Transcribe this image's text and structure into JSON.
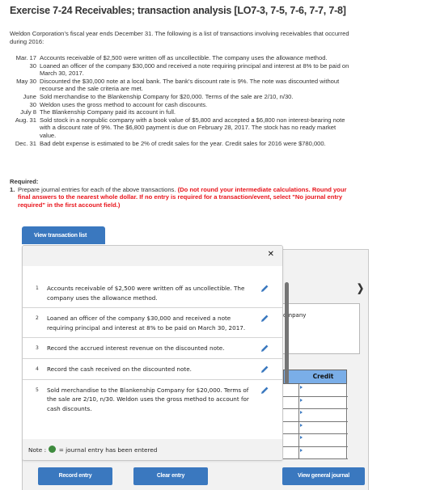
{
  "title": "Exercise 7-24 Receivables; transaction analysis [LO7-3, 7-5, 7-6, 7-7, 7-8]",
  "intro": "Weldon Corporation’s fiscal year ends December 31. The following is a list of transactions involving receivables that occurred during 2016:",
  "transactions": [
    {
      "date": "Mar. 17",
      "desc": "Accounts receivable of $2,500 were written off as uncollectible. The company uses the allowance method."
    },
    {
      "date": "30",
      "desc": "Loaned an officer of the company $30,000 and received a note requiring principal and interest at 8% to be paid on March 30, 2017."
    },
    {
      "date": "May 30",
      "desc": "Discounted the $30,000 note at a local bank. The bank’s discount rate is 9%. The note was discounted without recourse and the sale criteria are met."
    },
    {
      "date": "June",
      "desc": "Sold merchandise to the Blankenship Company for $20,000. Terms of the sale are 2/10, n/30."
    },
    {
      "date": "30",
      "desc": "Weldon uses the gross method to account for cash discounts."
    },
    {
      "date": "July 8",
      "desc": "The Blankenship Company paid its account in full."
    },
    {
      "date": "Aug. 31",
      "desc": "Sold stock in a nonpublic company with a book value of $5,800 and accepted a $6,800 non interest-bearing note with a discount rate of 9%. The $6,800 payment is due on February 28, 2017. The stock has no ready market value."
    },
    {
      "date": "Dec. 31",
      "desc": "Bad debt expense is estimated to be 2% of credit sales for the year. Credit sales for 2016 were $780,000."
    }
  ],
  "required": {
    "label": "Required:",
    "num": "1.",
    "text": "Prepare journal entries for each of the above transactions.",
    "instructions": "(Do not round your intermediate calculations. Round your final answers to the nearest whole dollar. If no entry is required for a transaction/event, select \"No journal entry required\" in the first account field.)"
  },
  "view_transaction_list_label": "View transaction list",
  "popup": {
    "close_glyph": "✕",
    "entries": [
      {
        "num": "1",
        "text": "Accounts receivable of $2,500 were written off as uncollectible. The company uses the allowance method."
      },
      {
        "num": "2",
        "text": "Loaned an officer of the company $30,000 and received a note requiring principal and interest at 8% to be paid on March 30, 2017."
      },
      {
        "num": "3",
        "text": "Record the accrued interest revenue on the discounted note."
      },
      {
        "num": "4",
        "text": "Record the cash received on the discounted note."
      },
      {
        "num": "5",
        "text": "Sold merchandise to the Blankenship Company for $20,000. Terms of the sale are 2/10, n/30. Weldon uses the gross method to account for cash discounts."
      }
    ],
    "note_prefix": "Note :",
    "note_suffix": "= journal entry has been entered",
    "note_color": "#3e8b3e"
  },
  "work_panel": {
    "next_glyph": "❯",
    "company_partial": "ompany",
    "credit_header": "Credit",
    "credit_rows": 6
  },
  "buttons": {
    "record_entry": "Record entry",
    "clear_entry": "Clear entry",
    "view_general_journal": "View general journal"
  },
  "colors": {
    "accent": "#3a78bf",
    "warning_text": "#e8141b",
    "table_header": "#7aaee8"
  }
}
